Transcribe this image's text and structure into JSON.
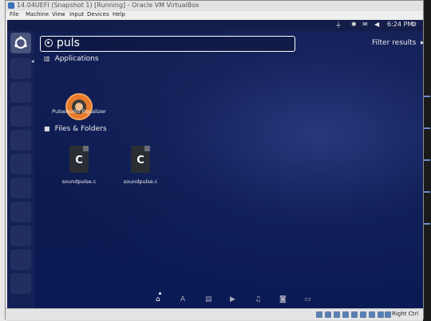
{
  "window": {
    "title": "14.04UEFI (Snapshot 1) [Running] - Oracle VM VirtualBox"
  },
  "menubar": [
    "File",
    "Machine",
    "View",
    "Input",
    "Devices",
    "Help"
  ],
  "panel": {
    "time": "6:24 PM"
  },
  "dash": {
    "search_value": "puls",
    "filter_label": "Filter results",
    "categories": [
      {
        "label": "Applications",
        "icon": "grid-icon"
      },
      {
        "label": "Files & Folders",
        "icon": "file-icon"
      }
    ],
    "applications": [
      {
        "label": "PulseAudio Equalizer",
        "icon": "pulseaudio-icon"
      }
    ],
    "files": [
      {
        "label": "soundpulse.c",
        "icon": "c-file-icon",
        "glyph": "C"
      },
      {
        "label": "soundpulse.c",
        "icon": "c-file-icon",
        "glyph": "C"
      }
    ],
    "lenses": [
      "home-lens-icon",
      "apps-lens-icon",
      "files-lens-icon",
      "video-lens-icon",
      "music-lens-icon",
      "photos-lens-icon",
      "social-lens-icon"
    ]
  },
  "statusbar": {
    "host_key": "Right Ctrl"
  },
  "colors": {
    "dash_bg": "#0e1a45",
    "accent": "#e87a2c"
  }
}
